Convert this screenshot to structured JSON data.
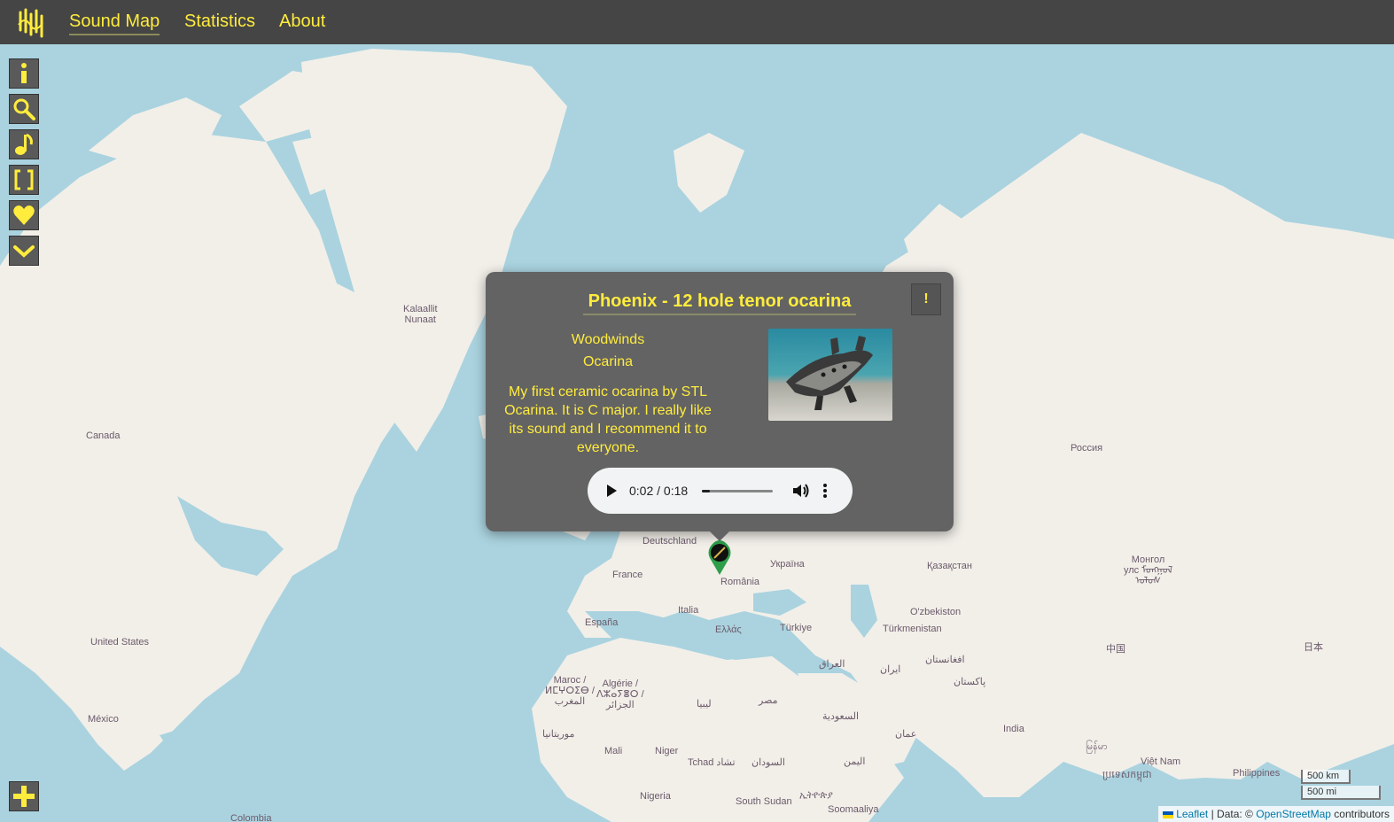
{
  "nav": {
    "links": [
      "Sound Map",
      "Statistics",
      "About"
    ],
    "active": "Sound Map"
  },
  "controls": {
    "icons": [
      "info-icon",
      "search-icon",
      "music-note-icon",
      "fullscreen-icon",
      "heart-icon",
      "chevron-down-icon",
      "plus-icon"
    ]
  },
  "colors": {
    "accent": "#ffec3d",
    "topbar": "#454545",
    "popup": "#636363",
    "marker": "#2e9e4a"
  },
  "popup": {
    "title": "Phoenix - 12 hole tenor ocarina",
    "report_label": "!",
    "category": "Woodwinds",
    "subcategory": "Ocarina",
    "description": "My first ceramic ocarina by STL Ocarina. It is C major. I really like its sound and I recommend it to everyone.",
    "audio": {
      "time": "0:02 / 0:18",
      "progress": 0.11
    }
  },
  "map_labels": {
    "kalaallit": "Kalaallit\nNunaat",
    "canada": "Canada",
    "united_states": "United States",
    "mexico": "México",
    "russia": "Россия",
    "deutschland": "Deutschland",
    "france": "France",
    "ukraina": "Україна",
    "romania": "România",
    "kazakhstan": "Қазақстан",
    "mongolia": "Монгол\nулс ᠮᠣᠩᠭᠣᠯ\nᠤᠯᠤᠰ",
    "italia": "Italia",
    "espana": "España",
    "ellas": "Ελλάς",
    "turkiye": "Türkiye",
    "uzbekiston": "O'zbekiston",
    "turkmenistan": "Türkmenistan",
    "iraq": "العراق",
    "iran": "ایران",
    "afghanistan": "افغانستان",
    "pakistan": "پاکستان",
    "china": "中国",
    "japan": "日本",
    "maroc": "Maroc /\nⵍⵎⵖⵔⵉⴱ /\nالمغرب",
    "algerie": "Algérie /\nⴷⵣⴰⵢⴻⵔ /\nالجزائر",
    "libya": "ليبيا",
    "egypt": "مصر",
    "saudi": "السعودية",
    "oman": "عمان",
    "mauritania": "موريتانيا",
    "mali": "Mali",
    "niger": "Niger",
    "tchad": "Tchad تشاد",
    "sudan": "السودان",
    "yemen": "اليمن",
    "india": "India",
    "myanmar": "မြန်မာ",
    "vietnam": "Việt Nam",
    "cambodia": "ប្រទេសកម្ពុជា",
    "philippines": "Philippines",
    "nigeria": "Nigeria",
    "south_sudan": "South Sudan",
    "ethiopia": "ኢትዮጵያ",
    "somaliya": "Soomaaliya",
    "colombia": "Colombia"
  },
  "scale": {
    "km": "500 km",
    "mi": "500 mi"
  },
  "attribution": {
    "leaflet": "Leaflet",
    "data_prefix": "| Data: ©",
    "osm": "OpenStreetMap",
    "suffix": "contributors"
  }
}
